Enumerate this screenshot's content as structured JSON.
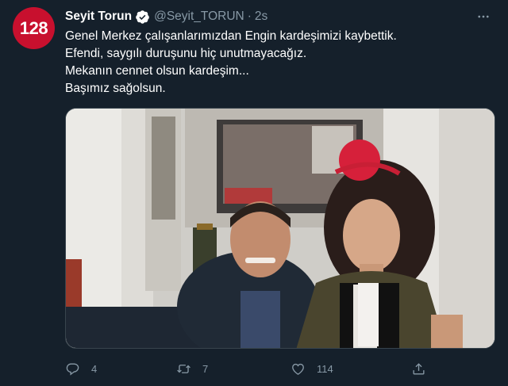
{
  "tweet": {
    "avatar_text": "128",
    "display_name": "Seyit Torun",
    "handle": "@Seyit_TORUN",
    "separator": "·",
    "time": "2s",
    "lines": [
      "Genel Merkez çalışanlarımızdan Engin kardeşimizi kaybettik.",
      "Efendi, saygılı duruşunu hiç unutmayacağız.",
      "Mekanın cennet olsun kardeşim...",
      "Başımız sağolsun."
    ],
    "replies": "4",
    "retweets": "7",
    "likes": "114"
  },
  "colors": {
    "background": "#15202b",
    "secondary_text": "#8899a6",
    "avatar_bg": "#c8102e",
    "verified": "#ffffff"
  },
  "icons": {
    "verified": "verified-badge-icon",
    "more": "more-dots-icon",
    "reply": "reply-icon",
    "retweet": "retweet-icon",
    "like": "heart-icon",
    "share": "share-icon"
  }
}
